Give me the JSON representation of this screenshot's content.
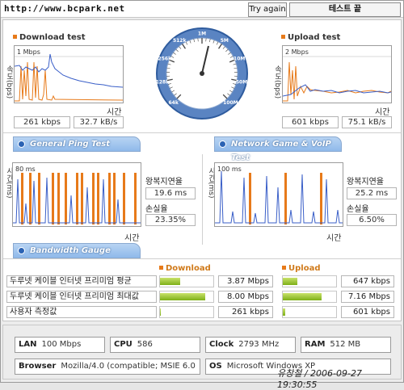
{
  "header": {
    "url": "http://www.bcpark.net",
    "try_again_label": "Try again",
    "status_label": "테스트 끝"
  },
  "download": {
    "title": "Download test",
    "y_axis": "속도(bps)",
    "scale": "1 Mbps",
    "x_axis": "시간",
    "kbps": "261 kbps",
    "kBs": "32.7 kB/s"
  },
  "upload": {
    "title": "Upload test",
    "y_axis": "속도(bps)",
    "scale": "2 Mbps",
    "x_axis": "시간",
    "kbps": "601 kbps",
    "kBs": "75.1 kB/s"
  },
  "gauge": {
    "ticks": [
      "64k",
      "128k",
      "256k",
      "512k",
      "1M",
      "5M",
      "10M",
      "50M",
      "100M"
    ]
  },
  "ping": {
    "tab_label": "General Ping Test",
    "y_axis": "시간(ms)",
    "scale": "80 ms",
    "x_axis": "시간",
    "rtt_label": "왕복지연율",
    "rtt_value": "19.6 ms",
    "loss_label": "손실율",
    "loss_value": "23.35%"
  },
  "game": {
    "tab_label": "Network Game & VoIP Test",
    "y_axis": "시간(ms)",
    "scale": "100 ms",
    "x_axis": "시간",
    "rtt_label": "왕복지연율",
    "rtt_value": "25.2 ms",
    "loss_label": "손실율",
    "loss_value": "6.50%"
  },
  "bandwidth": {
    "tab_label": "Bandwidth Gauge",
    "download_header": "Download",
    "upload_header": "Upload",
    "rows": [
      {
        "label": "두루넷 케이블 인터넷 프리미엄 평균",
        "down": "3.87 Mbps",
        "down_fill": 0.38,
        "up": "647 kbps",
        "up_fill": 0.27
      },
      {
        "label": "두루넷 케이블 인터넷 프리미엄 최대값",
        "down": "8.00 Mbps",
        "down_fill": 0.85,
        "up": "7.16 Mbps",
        "up_fill": 0.72
      },
      {
        "label": "사용자 측정값",
        "down": "261 kbps",
        "down_fill": 0.02,
        "up": "601 kbps",
        "up_fill": 0.05
      }
    ]
  },
  "system": {
    "lan_label": "LAN",
    "lan_value": "100 Mbps",
    "cpu_label": "CPU",
    "cpu_value": "586",
    "clock_label": "Clock",
    "clock_value": "2793 MHz",
    "ram_label": "RAM",
    "ram_value": "512 MB",
    "browser_label": "Browser",
    "browser_value": "Mozilla/4.0 (compatible; MSIE 6.0",
    "os_label": "OS",
    "os_value": "Microsoft Windows XP"
  },
  "signature": "유창철 / 2006-09-27 19:30:55",
  "colors": {
    "orange": "#e77a1a",
    "blue": "#3a5fc8",
    "tab": "#8fb9ea",
    "bar": "#7eb018"
  }
}
